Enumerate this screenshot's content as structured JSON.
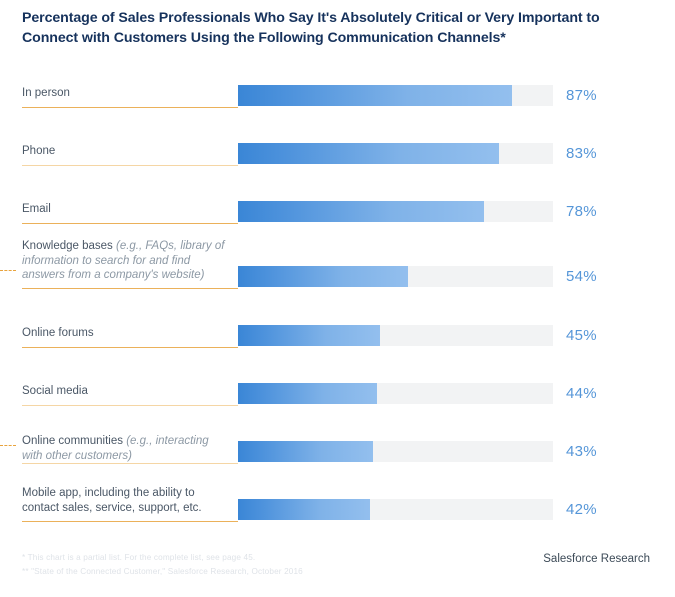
{
  "header": {
    "title": "Percentage of Sales Professionals Who Say It's Absolutely Critical or Very Important to Connect with Customers Using the Following Communication Channels*"
  },
  "footer": {
    "note_1": "* This chart is a partial list. For the complete list, see page 45.",
    "note_2": "** \"State of the Connected Customer,\" Salesforce Research, October 2016",
    "brand": "Salesforce Research"
  },
  "colors": {
    "title": "#16325c",
    "label": "#4a5766",
    "label_sub": "#8c98a4",
    "value": "#5596d8",
    "bar_start": "#3a86d6",
    "bar_end": "#93bfee",
    "track": "#f2f3f4",
    "rule": "#e8a33d",
    "rule_pale": "#f3cf95"
  },
  "chart_data": {
    "type": "bar",
    "title": "Percentage of Sales Professionals Who Say It's Absolutely Critical or Very Important to Connect with Customers Using the Following Communication Channels*",
    "orientation": "horizontal",
    "xlabel": "",
    "ylabel": "",
    "xlim": [
      0,
      100
    ],
    "grid": false,
    "legend": null,
    "unit": "%",
    "categories": [
      "In person",
      "Phone",
      "Email",
      "Knowledge bases (e.g., FAQs, library of information to search for and find answers from a company's website)",
      "Online forums",
      "Social media",
      "Online communities (e.g., interacting with other customers)",
      "Mobile app, including the ability to contact sales, service, support, etc."
    ],
    "values": [
      87,
      83,
      78,
      54,
      45,
      44,
      43,
      42
    ],
    "data_labels": [
      "87%",
      "83%",
      "78%",
      "54%",
      "45%",
      "44%",
      "43%",
      "42%"
    ]
  },
  "rows": [
    {
      "label_main": "In person",
      "label_sub": "",
      "value": 87,
      "value_label": "87%",
      "marker": false,
      "rule_pale": false
    },
    {
      "label_main": "Phone",
      "label_sub": "",
      "value": 83,
      "value_label": "83%",
      "marker": false,
      "rule_pale": true
    },
    {
      "label_main": "Email",
      "label_sub": "",
      "value": 78,
      "value_label": "78%",
      "marker": false,
      "rule_pale": false
    },
    {
      "label_main": "Knowledge bases ",
      "label_sub": "(e.g., FAQs, library of information to search for and find answers from a company's website)",
      "value": 54,
      "value_label": "54%",
      "marker": true,
      "rule_pale": false
    },
    {
      "label_main": "Online forums",
      "label_sub": "",
      "value": 45,
      "value_label": "45%",
      "marker": false,
      "rule_pale": false
    },
    {
      "label_main": "Social media",
      "label_sub": "",
      "value": 44,
      "value_label": "44%",
      "marker": false,
      "rule_pale": true
    },
    {
      "label_main": "Online communities ",
      "label_sub": "(e.g., interacting with other customers)",
      "value": 43,
      "value_label": "43%",
      "marker": true,
      "rule_pale": true
    },
    {
      "label_main": "Mobile app, including the ability to contact sales, service, support, etc.",
      "label_sub": "",
      "value": 42,
      "value_label": "42%",
      "marker": false,
      "rule_pale": false
    }
  ]
}
